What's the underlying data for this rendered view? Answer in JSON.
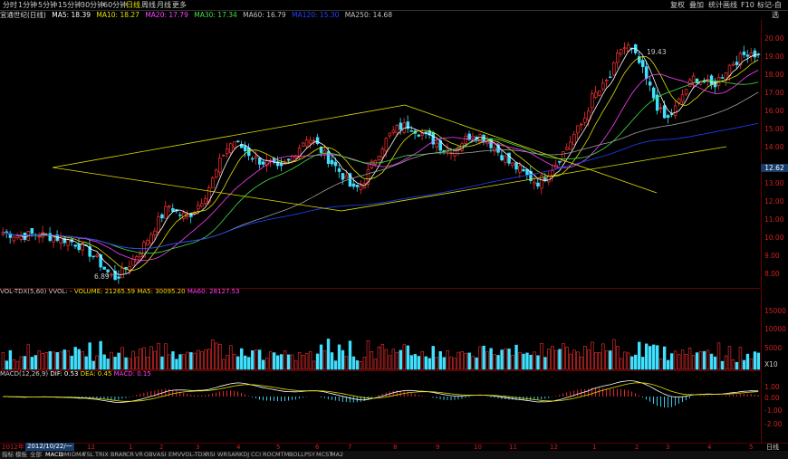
{
  "toolbar": {
    "periods": [
      "分时",
      "1分钟",
      "5分钟",
      "15分钟",
      "30分钟",
      "60分钟",
      "日线",
      "周线",
      "月线",
      "更多"
    ],
    "active_period": "日线",
    "right_buttons": [
      "复权",
      "叠加",
      "统计",
      "画线",
      "F10",
      "标记",
      "-自选"
    ]
  },
  "ma_bar": {
    "name": "宜通世纪(日线)",
    "items": [
      {
        "label": "MA5: 18.39",
        "color": "#ffffff"
      },
      {
        "label": "MA10: 18.27",
        "color": "#e0e000"
      },
      {
        "label": "MA20: 17.79",
        "color": "#ff40ff"
      },
      {
        "label": "MA30: 17.34",
        "color": "#40e040"
      },
      {
        "label": "MA60: 16.79",
        "color": "#c0c0c0"
      },
      {
        "label": "MA120: 15.30",
        "color": "#2040ff"
      },
      {
        "label": "MA250: 14.68",
        "color": "#c0c0c0"
      }
    ]
  },
  "price_axis": {
    "ticks": [
      "20.00",
      "19.00",
      "18.00",
      "17.00",
      "16.00",
      "15.00",
      "14.00",
      "13.00",
      "12.00",
      "11.00",
      "10.00",
      "9.00",
      "8.00",
      "7.00"
    ],
    "current_price": "12.62",
    "high_label": "19.43",
    "low_label": "6.89"
  },
  "volume": {
    "title_items": [
      {
        "label": "VOL-TDX(5,60)",
        "color": "#cccccc"
      },
      {
        "label": "VVOL: -",
        "color": "#cccccc"
      },
      {
        "label": "VOLUME: 21265.59",
        "color": "#e0e000"
      },
      {
        "label": "MA5: 30095.20",
        "color": "#e0e000"
      },
      {
        "label": "MA60: 28127.53",
        "color": "#ff40ff"
      }
    ],
    "ticks": [
      "15000",
      "10000",
      "5000"
    ],
    "unit": "X10"
  },
  "macd": {
    "title_items": [
      {
        "label": "MACD(12,26,9)",
        "color": "#cccccc"
      },
      {
        "label": "DIF: 0.53",
        "color": "#ffffff"
      },
      {
        "label": "DEA: 0.45",
        "color": "#e0e000"
      },
      {
        "label": "MACD: 0.15",
        "color": "#ff40ff"
      }
    ],
    "ticks": [
      "1.00",
      "0.00",
      "-1.00",
      "-2.00"
    ]
  },
  "date_axis": {
    "cursor_date": "2012/10/22/一",
    "left_label": "2012年",
    "labels": [
      "12",
      "1",
      "2",
      "3",
      "4",
      "5",
      "6",
      "7",
      "8",
      "9",
      "10",
      "11",
      "12",
      "1",
      "2",
      "3",
      "4",
      "5"
    ],
    "right_label": "日线"
  },
  "bottom_tabs": {
    "items": [
      "指标",
      "模板",
      "全部",
      "MACD",
      "DMI",
      "DMA",
      "FSL",
      "TRIX",
      "BRAR",
      "CR",
      "VR",
      "OBV",
      "ASI",
      "EMV",
      "VOL-TDX",
      "RSI",
      "WR",
      "SAR",
      "KDJ",
      "CCI",
      "ROC",
      "MTM",
      "BOLL",
      "PSY",
      "MCST",
      "MA2"
    ],
    "active": "MACD"
  },
  "chart_data": {
    "type": "candlestick",
    "price_range": [
      6.5,
      20.5
    ],
    "close_path": [
      9.4,
      9.3,
      9.2,
      9.3,
      9.3,
      9.2,
      9.1,
      9.0,
      8.8,
      8.5,
      8.1,
      7.5,
      7.0,
      7.3,
      7.9,
      8.5,
      9.3,
      10.1,
      10.8,
      10.4,
      10.2,
      10.7,
      11.4,
      12.4,
      13.6,
      14.2,
      13.8,
      13.4,
      13.1,
      13.0,
      12.6,
      13.1,
      13.8,
      14.4,
      14.0,
      13.4,
      12.9,
      12.3,
      11.6,
      11.9,
      12.9,
      13.8,
      14.5,
      14.9,
      15.0,
      14.7,
      14.4,
      14.1,
      13.7,
      13.8,
      14.2,
      14.6,
      14.4,
      14.0,
      13.5,
      13.0,
      12.7,
      12.3,
      12.0,
      12.4,
      13.0,
      13.7,
      14.5,
      15.2,
      16.5,
      16.9,
      17.6,
      19.0,
      19.1,
      18.3,
      17.2,
      16.0,
      15.2,
      15.9,
      16.8,
      17.5,
      17.3,
      17.0,
      17.6,
      18.2,
      18.5,
      18.9,
      18.6
    ]
  }
}
